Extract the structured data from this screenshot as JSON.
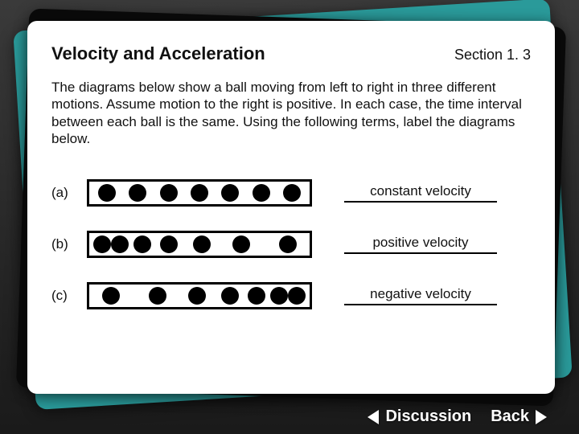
{
  "header": {
    "title": "Velocity and Acceleration",
    "section": "Section 1. 3"
  },
  "body": "The diagrams below show a ball moving from left to right in three different motions. Assume motion to the right is positive. In each case, the time interval between each ball is the same. Using the following terms, label the diagrams below.",
  "rows": {
    "a": {
      "label": "(a)",
      "answer": "constant velocity"
    },
    "b": {
      "label": "(b)",
      "answer": "positive velocity"
    },
    "c": {
      "label": "(c)",
      "answer": "negative velocity"
    }
  },
  "buttons": {
    "discussion": "Discussion",
    "back": "Back"
  }
}
